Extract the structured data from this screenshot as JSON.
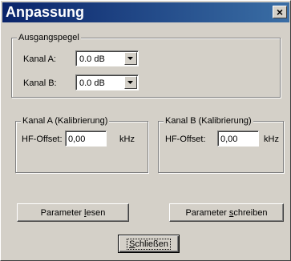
{
  "window": {
    "title": "Anpassung",
    "close_glyph": "×"
  },
  "ausgangspegel": {
    "legend": "Ausgangspegel",
    "kanal_a_label": "Kanal A:",
    "kanal_a_value": "0.0 dB",
    "kanal_b_label": "Kanal B:",
    "kanal_b_value": "0.0 dB"
  },
  "kal_a": {
    "legend": "Kanal A  (Kalibrierung)",
    "hf_label": "HF-Offset:",
    "hf_value": "0,00",
    "unit": "kHz"
  },
  "kal_b": {
    "legend": "Kanal B  (Kalibrierung)",
    "hf_label": "HF-Offset:",
    "hf_value": "0,00",
    "unit": "kHz"
  },
  "buttons": {
    "lesen_pre": "Parameter ",
    "lesen_acc": "l",
    "lesen_post": "esen",
    "schreiben_pre": "Parameter ",
    "schreiben_acc": "s",
    "schreiben_post": "chreiben",
    "close_acc": "S",
    "close_post": "chließen"
  }
}
